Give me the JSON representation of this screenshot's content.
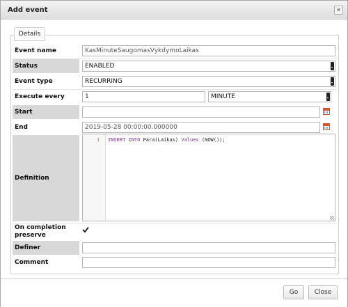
{
  "dialog": {
    "title": "Add event",
    "close_glyph": "✕"
  },
  "tab": {
    "label": "Details"
  },
  "fields": {
    "event_name": {
      "label": "Event name",
      "value": "KasMinuteSaugomasVykdymoLaikas"
    },
    "status": {
      "label": "Status",
      "value": "ENABLED"
    },
    "event_type": {
      "label": "Event type",
      "value": "RECURRING"
    },
    "execute_every": {
      "label": "Execute every",
      "value": "1",
      "unit": "MINUTE"
    },
    "start": {
      "label": "Start",
      "value": ""
    },
    "end": {
      "label": "End",
      "value": "2019-05-28 00:00:00.000000"
    },
    "definition": {
      "label": "Definition",
      "line_number": "1",
      "code_tokens": [
        "INSERT INTO",
        " Para(Laikas) ",
        "Values",
        " (NOW());"
      ]
    },
    "on_completion": {
      "label_line1": "On completion",
      "label_line2": "preserve",
      "checked": true
    },
    "definer": {
      "label": "Definer",
      "value": ""
    },
    "comment": {
      "label": "Comment",
      "value": ""
    }
  },
  "footer": {
    "go_label": "Go",
    "close_label": "Close"
  },
  "colors": {
    "label_shade": "#d8d8d8",
    "keyword": "#7a2a9a",
    "calendar_icon": "#d4572e"
  }
}
